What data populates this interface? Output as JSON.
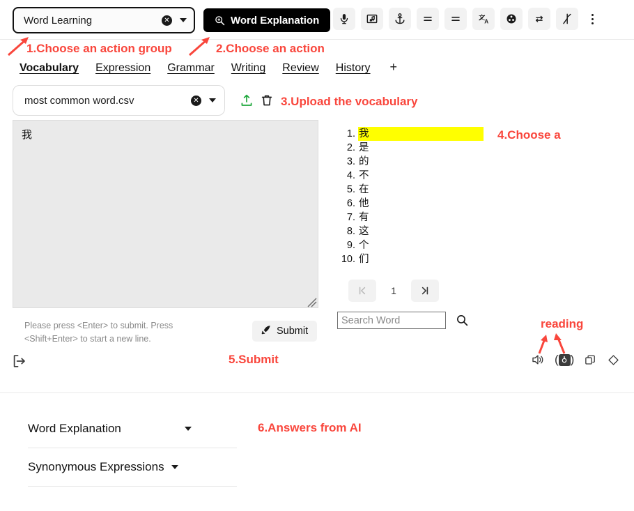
{
  "topbar": {
    "action_group": {
      "value": "Word Learning",
      "clear_icon": "clear-circle-icon",
      "caret_icon": "chevron-down-icon"
    },
    "action_button": {
      "label": "Word Explanation",
      "icon": "zoom-in-icon"
    },
    "tools": [
      {
        "name": "microphone-icon",
        "label": "Microphone"
      },
      {
        "name": "music-video-icon",
        "label": "Music"
      },
      {
        "name": "anchor-icon",
        "label": "Anchor"
      },
      {
        "name": "list-lines-icon",
        "label": "Lines"
      },
      {
        "name": "list-lines-2-icon",
        "label": "Lines 2"
      },
      {
        "name": "translate-icon",
        "label": "Translate"
      },
      {
        "name": "film-reel-icon",
        "label": "Film"
      },
      {
        "name": "swap-arrows-icon",
        "label": "Swap"
      },
      {
        "name": "merge-icon",
        "label": "Merge"
      }
    ],
    "more_menu": "kebab-menu-icon"
  },
  "annotations": [
    {
      "id": "anno-1",
      "text": "1.Choose an action group"
    },
    {
      "id": "anno-2",
      "text": "2.Choose an action"
    },
    {
      "id": "anno-3",
      "text": "3.Upload the vocabulary"
    },
    {
      "id": "anno-4",
      "text": "4.Choose a"
    },
    {
      "id": "anno-5",
      "text": "5.Submit"
    },
    {
      "id": "anno-6",
      "text": "6.Answers from AI"
    },
    {
      "id": "anno-7",
      "text": "reading"
    }
  ],
  "tabs": {
    "items": [
      {
        "label": "Vocabulary",
        "active": true
      },
      {
        "label": "Expression",
        "active": false
      },
      {
        "label": "Grammar",
        "active": false
      },
      {
        "label": "Writing",
        "active": false
      },
      {
        "label": "Review",
        "active": false
      },
      {
        "label": "History",
        "active": false
      }
    ],
    "add_label": "+"
  },
  "file_row": {
    "file_name": "most common word.csv",
    "clear_icon": "clear-circle-icon",
    "caret_icon": "chevron-down-icon",
    "upload_icon": "upload-icon",
    "delete_icon": "trash-icon",
    "upload_color": "#1fa83c"
  },
  "compose": {
    "value": "我",
    "placeholder": "",
    "hint": "Please press <Enter> to submit. Press <Shift+Enter> to start a new line.",
    "submit_label": "Submit",
    "submit_icon": "rocket-icon",
    "logout_icon": "logout-icon"
  },
  "wordlist": {
    "items": [
      {
        "num": "1.",
        "word": "我",
        "selected": true
      },
      {
        "num": "2.",
        "word": "是",
        "selected": false
      },
      {
        "num": "3.",
        "word": "的",
        "selected": false
      },
      {
        "num": "4.",
        "word": "不",
        "selected": false
      },
      {
        "num": "5.",
        "word": "在",
        "selected": false
      },
      {
        "num": "6.",
        "word": "他",
        "selected": false
      },
      {
        "num": "7.",
        "word": "有",
        "selected": false
      },
      {
        "num": "8.",
        "word": "这",
        "selected": false
      },
      {
        "num": "9.",
        "word": "个",
        "selected": false
      },
      {
        "num": "10.",
        "word": "们",
        "selected": false
      }
    ],
    "highlight_color": "#ffff00"
  },
  "pager": {
    "first_label": "|◁",
    "page": "1",
    "last_label": "▷|"
  },
  "search": {
    "placeholder": "Search Word",
    "value": "",
    "icon": "search-icon"
  },
  "media": {
    "icons": [
      {
        "name": "speaker-icon",
        "active": false
      },
      {
        "name": "speaker-active-icon",
        "active": true
      },
      {
        "name": "copy-icon",
        "active": false
      },
      {
        "name": "eraser-icon",
        "active": false
      }
    ]
  },
  "accordion": {
    "items": [
      {
        "label": "Word Explanation",
        "caret": "chevron-down-icon"
      },
      {
        "label": "Synonymous Expressions",
        "caret": "chevron-down-icon"
      }
    ]
  }
}
